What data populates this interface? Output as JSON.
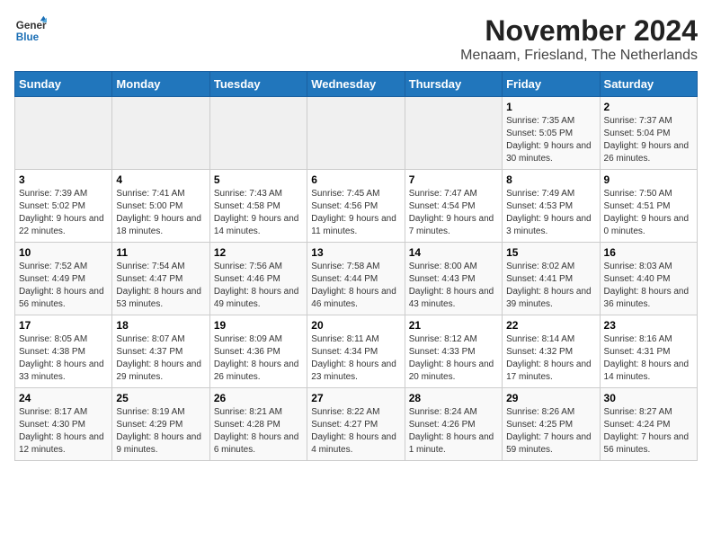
{
  "logo": {
    "text_general": "General",
    "text_blue": "Blue"
  },
  "title": "November 2024",
  "subtitle": "Menaam, Friesland, The Netherlands",
  "weekdays": [
    "Sunday",
    "Monday",
    "Tuesday",
    "Wednesday",
    "Thursday",
    "Friday",
    "Saturday"
  ],
  "weeks": [
    [
      {
        "day": "",
        "info": ""
      },
      {
        "day": "",
        "info": ""
      },
      {
        "day": "",
        "info": ""
      },
      {
        "day": "",
        "info": ""
      },
      {
        "day": "",
        "info": ""
      },
      {
        "day": "1",
        "info": "Sunrise: 7:35 AM\nSunset: 5:05 PM\nDaylight: 9 hours and 30 minutes."
      },
      {
        "day": "2",
        "info": "Sunrise: 7:37 AM\nSunset: 5:04 PM\nDaylight: 9 hours and 26 minutes."
      }
    ],
    [
      {
        "day": "3",
        "info": "Sunrise: 7:39 AM\nSunset: 5:02 PM\nDaylight: 9 hours and 22 minutes."
      },
      {
        "day": "4",
        "info": "Sunrise: 7:41 AM\nSunset: 5:00 PM\nDaylight: 9 hours and 18 minutes."
      },
      {
        "day": "5",
        "info": "Sunrise: 7:43 AM\nSunset: 4:58 PM\nDaylight: 9 hours and 14 minutes."
      },
      {
        "day": "6",
        "info": "Sunrise: 7:45 AM\nSunset: 4:56 PM\nDaylight: 9 hours and 11 minutes."
      },
      {
        "day": "7",
        "info": "Sunrise: 7:47 AM\nSunset: 4:54 PM\nDaylight: 9 hours and 7 minutes."
      },
      {
        "day": "8",
        "info": "Sunrise: 7:49 AM\nSunset: 4:53 PM\nDaylight: 9 hours and 3 minutes."
      },
      {
        "day": "9",
        "info": "Sunrise: 7:50 AM\nSunset: 4:51 PM\nDaylight: 9 hours and 0 minutes."
      }
    ],
    [
      {
        "day": "10",
        "info": "Sunrise: 7:52 AM\nSunset: 4:49 PM\nDaylight: 8 hours and 56 minutes."
      },
      {
        "day": "11",
        "info": "Sunrise: 7:54 AM\nSunset: 4:47 PM\nDaylight: 8 hours and 53 minutes."
      },
      {
        "day": "12",
        "info": "Sunrise: 7:56 AM\nSunset: 4:46 PM\nDaylight: 8 hours and 49 minutes."
      },
      {
        "day": "13",
        "info": "Sunrise: 7:58 AM\nSunset: 4:44 PM\nDaylight: 8 hours and 46 minutes."
      },
      {
        "day": "14",
        "info": "Sunrise: 8:00 AM\nSunset: 4:43 PM\nDaylight: 8 hours and 43 minutes."
      },
      {
        "day": "15",
        "info": "Sunrise: 8:02 AM\nSunset: 4:41 PM\nDaylight: 8 hours and 39 minutes."
      },
      {
        "day": "16",
        "info": "Sunrise: 8:03 AM\nSunset: 4:40 PM\nDaylight: 8 hours and 36 minutes."
      }
    ],
    [
      {
        "day": "17",
        "info": "Sunrise: 8:05 AM\nSunset: 4:38 PM\nDaylight: 8 hours and 33 minutes."
      },
      {
        "day": "18",
        "info": "Sunrise: 8:07 AM\nSunset: 4:37 PM\nDaylight: 8 hours and 29 minutes."
      },
      {
        "day": "19",
        "info": "Sunrise: 8:09 AM\nSunset: 4:36 PM\nDaylight: 8 hours and 26 minutes."
      },
      {
        "day": "20",
        "info": "Sunrise: 8:11 AM\nSunset: 4:34 PM\nDaylight: 8 hours and 23 minutes."
      },
      {
        "day": "21",
        "info": "Sunrise: 8:12 AM\nSunset: 4:33 PM\nDaylight: 8 hours and 20 minutes."
      },
      {
        "day": "22",
        "info": "Sunrise: 8:14 AM\nSunset: 4:32 PM\nDaylight: 8 hours and 17 minutes."
      },
      {
        "day": "23",
        "info": "Sunrise: 8:16 AM\nSunset: 4:31 PM\nDaylight: 8 hours and 14 minutes."
      }
    ],
    [
      {
        "day": "24",
        "info": "Sunrise: 8:17 AM\nSunset: 4:30 PM\nDaylight: 8 hours and 12 minutes."
      },
      {
        "day": "25",
        "info": "Sunrise: 8:19 AM\nSunset: 4:29 PM\nDaylight: 8 hours and 9 minutes."
      },
      {
        "day": "26",
        "info": "Sunrise: 8:21 AM\nSunset: 4:28 PM\nDaylight: 8 hours and 6 minutes."
      },
      {
        "day": "27",
        "info": "Sunrise: 8:22 AM\nSunset: 4:27 PM\nDaylight: 8 hours and 4 minutes."
      },
      {
        "day": "28",
        "info": "Sunrise: 8:24 AM\nSunset: 4:26 PM\nDaylight: 8 hours and 1 minute."
      },
      {
        "day": "29",
        "info": "Sunrise: 8:26 AM\nSunset: 4:25 PM\nDaylight: 7 hours and 59 minutes."
      },
      {
        "day": "30",
        "info": "Sunrise: 8:27 AM\nSunset: 4:24 PM\nDaylight: 7 hours and 56 minutes."
      }
    ]
  ]
}
